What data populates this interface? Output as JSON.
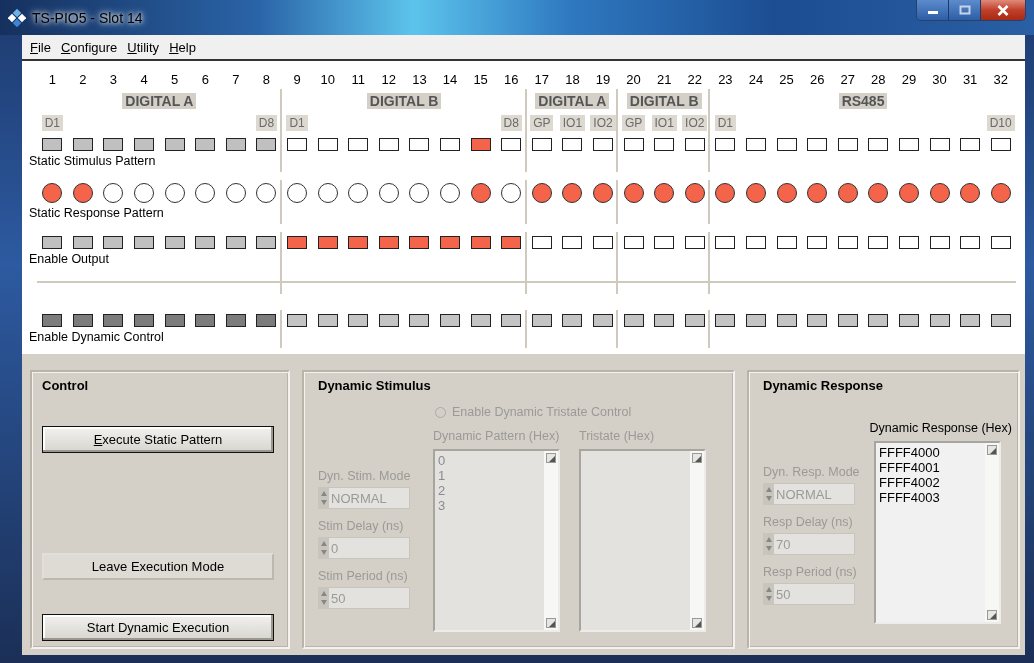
{
  "window": {
    "title": "TS-PIO5 - Slot 14"
  },
  "menu": [
    {
      "label": "File"
    },
    {
      "label": "Configure"
    },
    {
      "label": "Utility"
    },
    {
      "label": "Help"
    }
  ],
  "matrix": {
    "row_labels": [
      "Static Stimulus Pattern",
      "Static Response Pattern",
      "Enable Output",
      "Enable Dynamic Control"
    ],
    "groups": [
      {
        "title": "DIGITAL A",
        "channels": [
          {
            "number": "1",
            "tag": "D1",
            "stimulus_on": false,
            "stimulus_disabled": true,
            "response_on": true,
            "output_on": false,
            "output_disabled": true,
            "dynamic_on": true
          },
          {
            "number": "2",
            "stimulus_on": false,
            "stimulus_disabled": true,
            "response_on": true,
            "output_on": false,
            "output_disabled": true,
            "dynamic_on": true
          },
          {
            "number": "3",
            "stimulus_on": false,
            "stimulus_disabled": true,
            "response_on": false,
            "output_on": false,
            "output_disabled": true,
            "dynamic_on": true
          },
          {
            "number": "4",
            "stimulus_on": false,
            "stimulus_disabled": true,
            "response_on": false,
            "output_on": false,
            "output_disabled": true,
            "dynamic_on": true
          },
          {
            "number": "5",
            "stimulus_on": false,
            "stimulus_disabled": true,
            "response_on": false,
            "output_on": false,
            "output_disabled": true,
            "dynamic_on": true
          },
          {
            "number": "6",
            "stimulus_on": false,
            "stimulus_disabled": true,
            "response_on": false,
            "output_on": false,
            "output_disabled": true,
            "dynamic_on": true
          },
          {
            "number": "7",
            "stimulus_on": false,
            "stimulus_disabled": true,
            "response_on": false,
            "output_on": false,
            "output_disabled": true,
            "dynamic_on": true
          },
          {
            "number": "8",
            "tag": "D8",
            "stimulus_on": false,
            "stimulus_disabled": true,
            "response_on": false,
            "output_on": false,
            "output_disabled": true,
            "dynamic_on": true
          }
        ]
      },
      {
        "title": "DIGITAL B",
        "channels": [
          {
            "number": "9",
            "tag": "D1",
            "stimulus_on": false,
            "stimulus_disabled": false,
            "response_on": false,
            "output_on": true,
            "output_disabled": false,
            "dynamic_on": false
          },
          {
            "number": "10",
            "stimulus_on": false,
            "stimulus_disabled": false,
            "response_on": false,
            "output_on": true,
            "output_disabled": false,
            "dynamic_on": false
          },
          {
            "number": "11",
            "stimulus_on": false,
            "stimulus_disabled": false,
            "response_on": false,
            "output_on": true,
            "output_disabled": false,
            "dynamic_on": false
          },
          {
            "number": "12",
            "stimulus_on": false,
            "stimulus_disabled": false,
            "response_on": false,
            "output_on": true,
            "output_disabled": false,
            "dynamic_on": false
          },
          {
            "number": "13",
            "stimulus_on": false,
            "stimulus_disabled": false,
            "response_on": false,
            "output_on": true,
            "output_disabled": false,
            "dynamic_on": false
          },
          {
            "number": "14",
            "stimulus_on": false,
            "stimulus_disabled": false,
            "response_on": false,
            "output_on": true,
            "output_disabled": false,
            "dynamic_on": false
          },
          {
            "number": "15",
            "stimulus_on": true,
            "stimulus_disabled": false,
            "response_on": true,
            "output_on": true,
            "output_disabled": false,
            "dynamic_on": false
          },
          {
            "number": "16",
            "tag": "D8",
            "stimulus_on": false,
            "stimulus_disabled": false,
            "response_on": false,
            "output_on": true,
            "output_disabled": false,
            "dynamic_on": false
          }
        ]
      },
      {
        "title": "DIGITAL A",
        "channels": [
          {
            "number": "17",
            "tag": "GP",
            "stimulus_on": false,
            "stimulus_disabled": false,
            "response_on": true,
            "output_on": false,
            "output_disabled": false,
            "dynamic_on": false
          },
          {
            "number": "18",
            "tag": "IO1",
            "stimulus_on": false,
            "stimulus_disabled": false,
            "response_on": true,
            "output_on": false,
            "output_disabled": false,
            "dynamic_on": false
          },
          {
            "number": "19",
            "tag": "IO2",
            "stimulus_on": false,
            "stimulus_disabled": false,
            "response_on": true,
            "output_on": false,
            "output_disabled": false,
            "dynamic_on": false
          }
        ]
      },
      {
        "title": "DIGITAL B",
        "channels": [
          {
            "number": "20",
            "tag": "GP",
            "stimulus_on": false,
            "stimulus_disabled": false,
            "response_on": true,
            "output_on": false,
            "output_disabled": false,
            "dynamic_on": false
          },
          {
            "number": "21",
            "tag": "IO1",
            "stimulus_on": false,
            "stimulus_disabled": false,
            "response_on": true,
            "output_on": false,
            "output_disabled": false,
            "dynamic_on": false
          },
          {
            "number": "22",
            "tag": "IO2",
            "stimulus_on": false,
            "stimulus_disabled": false,
            "response_on": true,
            "output_on": false,
            "output_disabled": false,
            "dynamic_on": false
          }
        ]
      },
      {
        "title": "RS485",
        "channels": [
          {
            "number": "23",
            "tag": "D1",
            "stimulus_on": false,
            "stimulus_disabled": false,
            "response_on": true,
            "output_on": false,
            "output_disabled": false,
            "dynamic_on": false
          },
          {
            "number": "24",
            "stimulus_on": false,
            "stimulus_disabled": false,
            "response_on": true,
            "output_on": false,
            "output_disabled": false,
            "dynamic_on": false
          },
          {
            "number": "25",
            "stimulus_on": false,
            "stimulus_disabled": false,
            "response_on": true,
            "output_on": false,
            "output_disabled": false,
            "dynamic_on": false
          },
          {
            "number": "26",
            "stimulus_on": false,
            "stimulus_disabled": false,
            "response_on": true,
            "output_on": false,
            "output_disabled": false,
            "dynamic_on": false
          },
          {
            "number": "27",
            "stimulus_on": false,
            "stimulus_disabled": false,
            "response_on": true,
            "output_on": false,
            "output_disabled": false,
            "dynamic_on": false
          },
          {
            "number": "28",
            "stimulus_on": false,
            "stimulus_disabled": false,
            "response_on": true,
            "output_on": false,
            "output_disabled": false,
            "dynamic_on": false
          },
          {
            "number": "29",
            "stimulus_on": false,
            "stimulus_disabled": false,
            "response_on": true,
            "output_on": false,
            "output_disabled": false,
            "dynamic_on": false
          },
          {
            "number": "30",
            "stimulus_on": false,
            "stimulus_disabled": false,
            "response_on": true,
            "output_on": false,
            "output_disabled": false,
            "dynamic_on": false
          },
          {
            "number": "31",
            "stimulus_on": false,
            "stimulus_disabled": false,
            "response_on": true,
            "output_on": false,
            "output_disabled": false,
            "dynamic_on": false
          },
          {
            "number": "32",
            "tag": "D10",
            "stimulus_on": false,
            "stimulus_disabled": false,
            "response_on": true,
            "output_on": false,
            "output_disabled": false,
            "dynamic_on": false
          }
        ]
      }
    ]
  },
  "control": {
    "title": "Control",
    "buttons": [
      {
        "label": "Execute Static Pattern",
        "kind": "framed",
        "mnemonic": true
      },
      {
        "label": "Leave Execution Mode",
        "kind": "flat",
        "mnemonic": false
      },
      {
        "label": "Start Dynamic Execution",
        "kind": "framed",
        "mnemonic": false
      }
    ]
  },
  "dynamic_stimulus": {
    "title": "Dynamic Stimulus",
    "tristate_radio": {
      "label": "Enable Dynamic Tristate Control",
      "checked": false,
      "disabled": true
    },
    "fields": [
      {
        "label": "Dyn. Stim. Mode",
        "value": "NORMAL",
        "disabled": true
      },
      {
        "label": "Stim Delay (ns)",
        "value": "0",
        "disabled": true
      },
      {
        "label": "Stim Period (ns)",
        "value": "50",
        "disabled": true
      }
    ],
    "lists": [
      {
        "label": "Dynamic Pattern (Hex)",
        "items": [
          "0",
          "1",
          "2",
          "3"
        ],
        "disabled": true
      },
      {
        "label": "Tristate (Hex)",
        "disabled": true
      }
    ]
  },
  "dynamic_response": {
    "title": "Dynamic Response",
    "fields": [
      {
        "label": "Dyn. Resp. Mode",
        "value": "NORMAL",
        "disabled": true
      },
      {
        "label": "Resp Delay (ns)",
        "value": "70",
        "disabled": true
      },
      {
        "label": "Resp Period (ns)",
        "value": "50",
        "disabled": true
      }
    ],
    "list": {
      "label": "Dynamic Response (Hex)",
      "items": [
        "FFFF4000",
        "FFFF4001",
        "FFFF4002",
        "FFFF4003"
      ],
      "disabled": false
    }
  }
}
